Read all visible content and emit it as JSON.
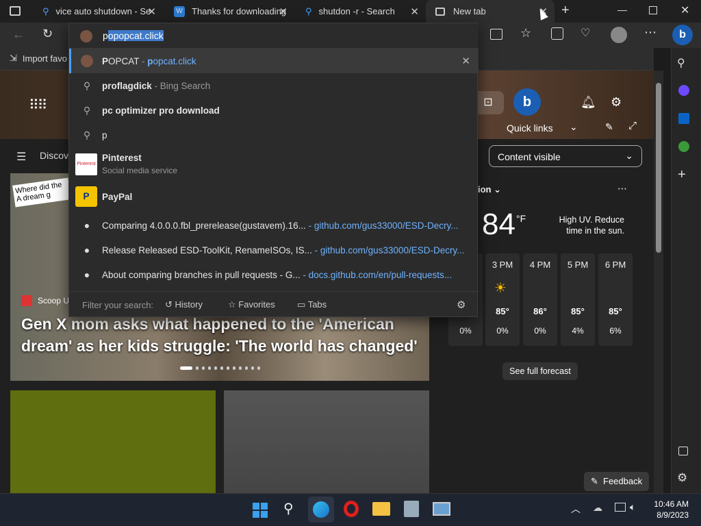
{
  "tabs": [
    {
      "label": "vice auto shutdown - Se",
      "icon": "search-icon"
    },
    {
      "label": "Thanks for downloading",
      "icon": "word-icon"
    },
    {
      "label": "shutdon -r - Search",
      "icon": "search-icon"
    },
    {
      "label": "New tab",
      "icon": "newtab-icon"
    }
  ],
  "address": {
    "typed": "p",
    "completion": "opopcat.click"
  },
  "favbar": {
    "import_label": "Import favo"
  },
  "suggestions": [
    {
      "bold": "P",
      "rest": "OPCAT",
      "sep": " - ",
      "url_bold": "p",
      "url_rest": "opcat.click",
      "icon": "popcat-icon"
    },
    {
      "bold": "p",
      "rest": "roflagdick",
      "sub": " - Bing Search",
      "icon": "search-icon"
    },
    {
      "bold": "p",
      "rest": "c optimizer pro download",
      "icon": "search-icon"
    },
    {
      "text": "p",
      "icon": "search-icon"
    },
    {
      "title": "Pinterest",
      "sub": "Social media service",
      "icon": "pinterest-icon"
    },
    {
      "title": "PayPal",
      "icon": "paypal-icon"
    },
    {
      "text": "Comparing 4.0.0.0.fbl_prerelease(gustavem).16...",
      "link": " - github.com/gus33000/ESD-Decry...",
      "icon": "github-icon"
    },
    {
      "text": "Release Released ESD-ToolKit, RenameISOs, IS...",
      "link": " - github.com/gus33000/ESD-Decry...",
      "icon": "github-icon"
    },
    {
      "text": "About comparing branches in pull requests - G...",
      "link": " - docs.github.com/en/pull-requests...",
      "icon": "github-icon"
    }
  ],
  "filter": {
    "label": "Filter your search:",
    "history": "History",
    "favorites": "Favorites",
    "tabs": "Tabs"
  },
  "newtab": {
    "quick_links": "Quick links",
    "discover": "Discov",
    "content_visible": "Content visible",
    "location_partial": "ion",
    "temp": "84",
    "unit": "°F",
    "uv": "High UV. Reduce time in the sun.",
    "hours": [
      {
        "h": "3 PM",
        "t": "85°",
        "p": "0%"
      },
      {
        "h": "4 PM",
        "t": "86°",
        "p": "0%"
      },
      {
        "h": "5 PM",
        "t": "85°",
        "p": "4%"
      },
      {
        "h": "6 PM",
        "t": "85°",
        "p": "6%"
      }
    ],
    "extra_precip": "0%",
    "forecast_btn": "See full forecast",
    "source": "Scoop U",
    "headline": "Gen X mom asks what happened to the 'American dream' as her kids struggle: 'The world has changed'",
    "thumb_caption": "Where did the A dream g",
    "feedback": "Feedback"
  },
  "clock": {
    "time": "10:46 AM",
    "date": "8/9/2023"
  }
}
